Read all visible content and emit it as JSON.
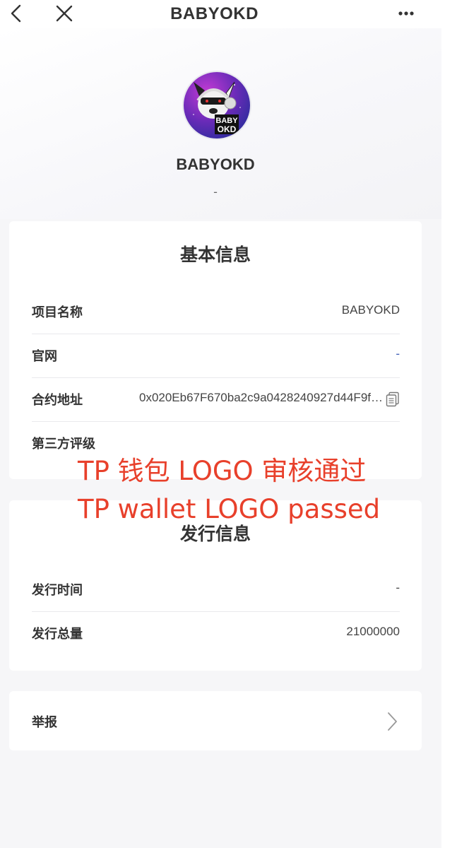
{
  "nav": {
    "title": "BABYOKD",
    "icons": [
      "chevron-left-icon",
      "close-icon",
      "more-icon"
    ]
  },
  "token": {
    "name": "BABYOKD",
    "subtitle": "-",
    "logo_text_top": "BABY",
    "logo_text_bottom": "OKD"
  },
  "basic_info": {
    "title": "基本信息",
    "rows": [
      {
        "label": "项目名称",
        "value": "BABYOKD"
      },
      {
        "label": "官网",
        "value": "-"
      },
      {
        "label": "合约地址",
        "value": "0x020Eb67F670ba2c9a0428240927d44F9f…"
      },
      {
        "label": "第三方评级",
        "value": ""
      }
    ]
  },
  "issue_info": {
    "title": "发行信息",
    "rows": [
      {
        "label": "发行时间",
        "value": "-"
      },
      {
        "label": "发行总量",
        "value": "21000000"
      }
    ]
  },
  "report": {
    "label": "举报"
  },
  "overlay_text": {
    "line1": "TP 钱包 LOGO 审核通过",
    "line2": "TP wallet LOGO passed"
  },
  "colors": {
    "overlay": "#e8402b",
    "link": "#3b5bb5",
    "background": "#f6f6f8"
  }
}
